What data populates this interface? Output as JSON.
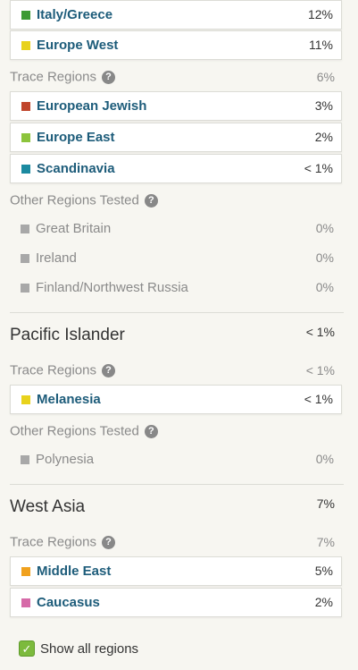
{
  "colors": {
    "italy_greece": "#3d9a33",
    "europe_west": "#e8d21c",
    "european_jewish": "#c0452b",
    "europe_east": "#8cc43c",
    "scandinavia": "#1b8aa0",
    "melanesia": "#e8d21c",
    "middle_east": "#f0a11e",
    "caucasus": "#d66aa8",
    "untested_grey": "#a8a8a8"
  },
  "europe": {
    "rows_top": [
      {
        "label": "Italy/Greece",
        "percent": "12%"
      },
      {
        "label": "Europe West",
        "percent": "11%"
      }
    ],
    "trace_label": "Trace Regions",
    "trace_percent": "6%",
    "trace_rows": [
      {
        "label": "European Jewish",
        "percent": "3%"
      },
      {
        "label": "Europe East",
        "percent": "2%"
      },
      {
        "label": "Scandinavia",
        "percent": "< 1%"
      }
    ],
    "other_label": "Other Regions Tested",
    "other_rows": [
      {
        "label": "Great Britain",
        "percent": "0%"
      },
      {
        "label": "Ireland",
        "percent": "0%"
      },
      {
        "label": "Finland/Northwest Russia",
        "percent": "0%"
      }
    ]
  },
  "pacific": {
    "title": "Pacific Islander",
    "percent": "< 1%",
    "trace_label": "Trace Regions",
    "trace_percent": "< 1%",
    "trace_rows": [
      {
        "label": "Melanesia",
        "percent": "< 1%"
      }
    ],
    "other_label": "Other Regions Tested",
    "other_rows": [
      {
        "label": "Polynesia",
        "percent": "0%"
      }
    ]
  },
  "west_asia": {
    "title": "West Asia",
    "percent": "7%",
    "trace_label": "Trace Regions",
    "trace_percent": "7%",
    "trace_rows": [
      {
        "label": "Middle East",
        "percent": "5%"
      },
      {
        "label": "Caucasus",
        "percent": "2%"
      }
    ]
  },
  "help_icon_glyph": "?",
  "checkmark_glyph": "✓",
  "show_all_label": "Show all regions"
}
